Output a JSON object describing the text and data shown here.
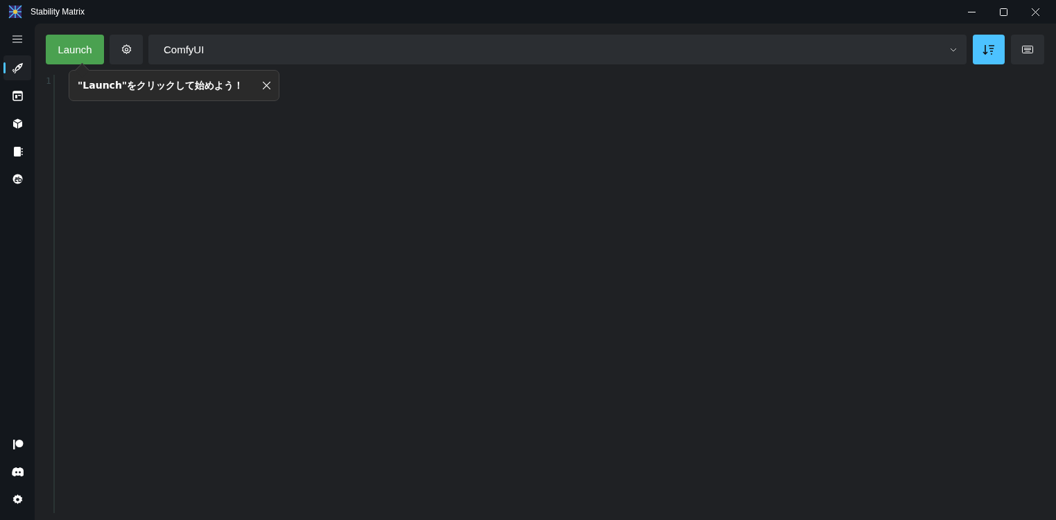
{
  "window": {
    "title": "Stability Matrix"
  },
  "sidebar": {
    "items": [
      {
        "kind": "rocket",
        "selected": true
      },
      {
        "kind": "layout",
        "selected": false
      },
      {
        "kind": "box",
        "selected": false
      },
      {
        "kind": "book",
        "selected": false
      },
      {
        "kind": "brain",
        "selected": false
      }
    ],
    "footer": [
      {
        "kind": "patreon"
      },
      {
        "kind": "discord"
      },
      {
        "kind": "gear"
      }
    ]
  },
  "toolbar": {
    "launch_button": "Launch",
    "package": {
      "value": "ComfyUI"
    }
  },
  "console": {
    "line_numbers": [
      "1"
    ]
  },
  "tip": {
    "text": "\"Launch\"をクリックして始めよう！"
  }
}
